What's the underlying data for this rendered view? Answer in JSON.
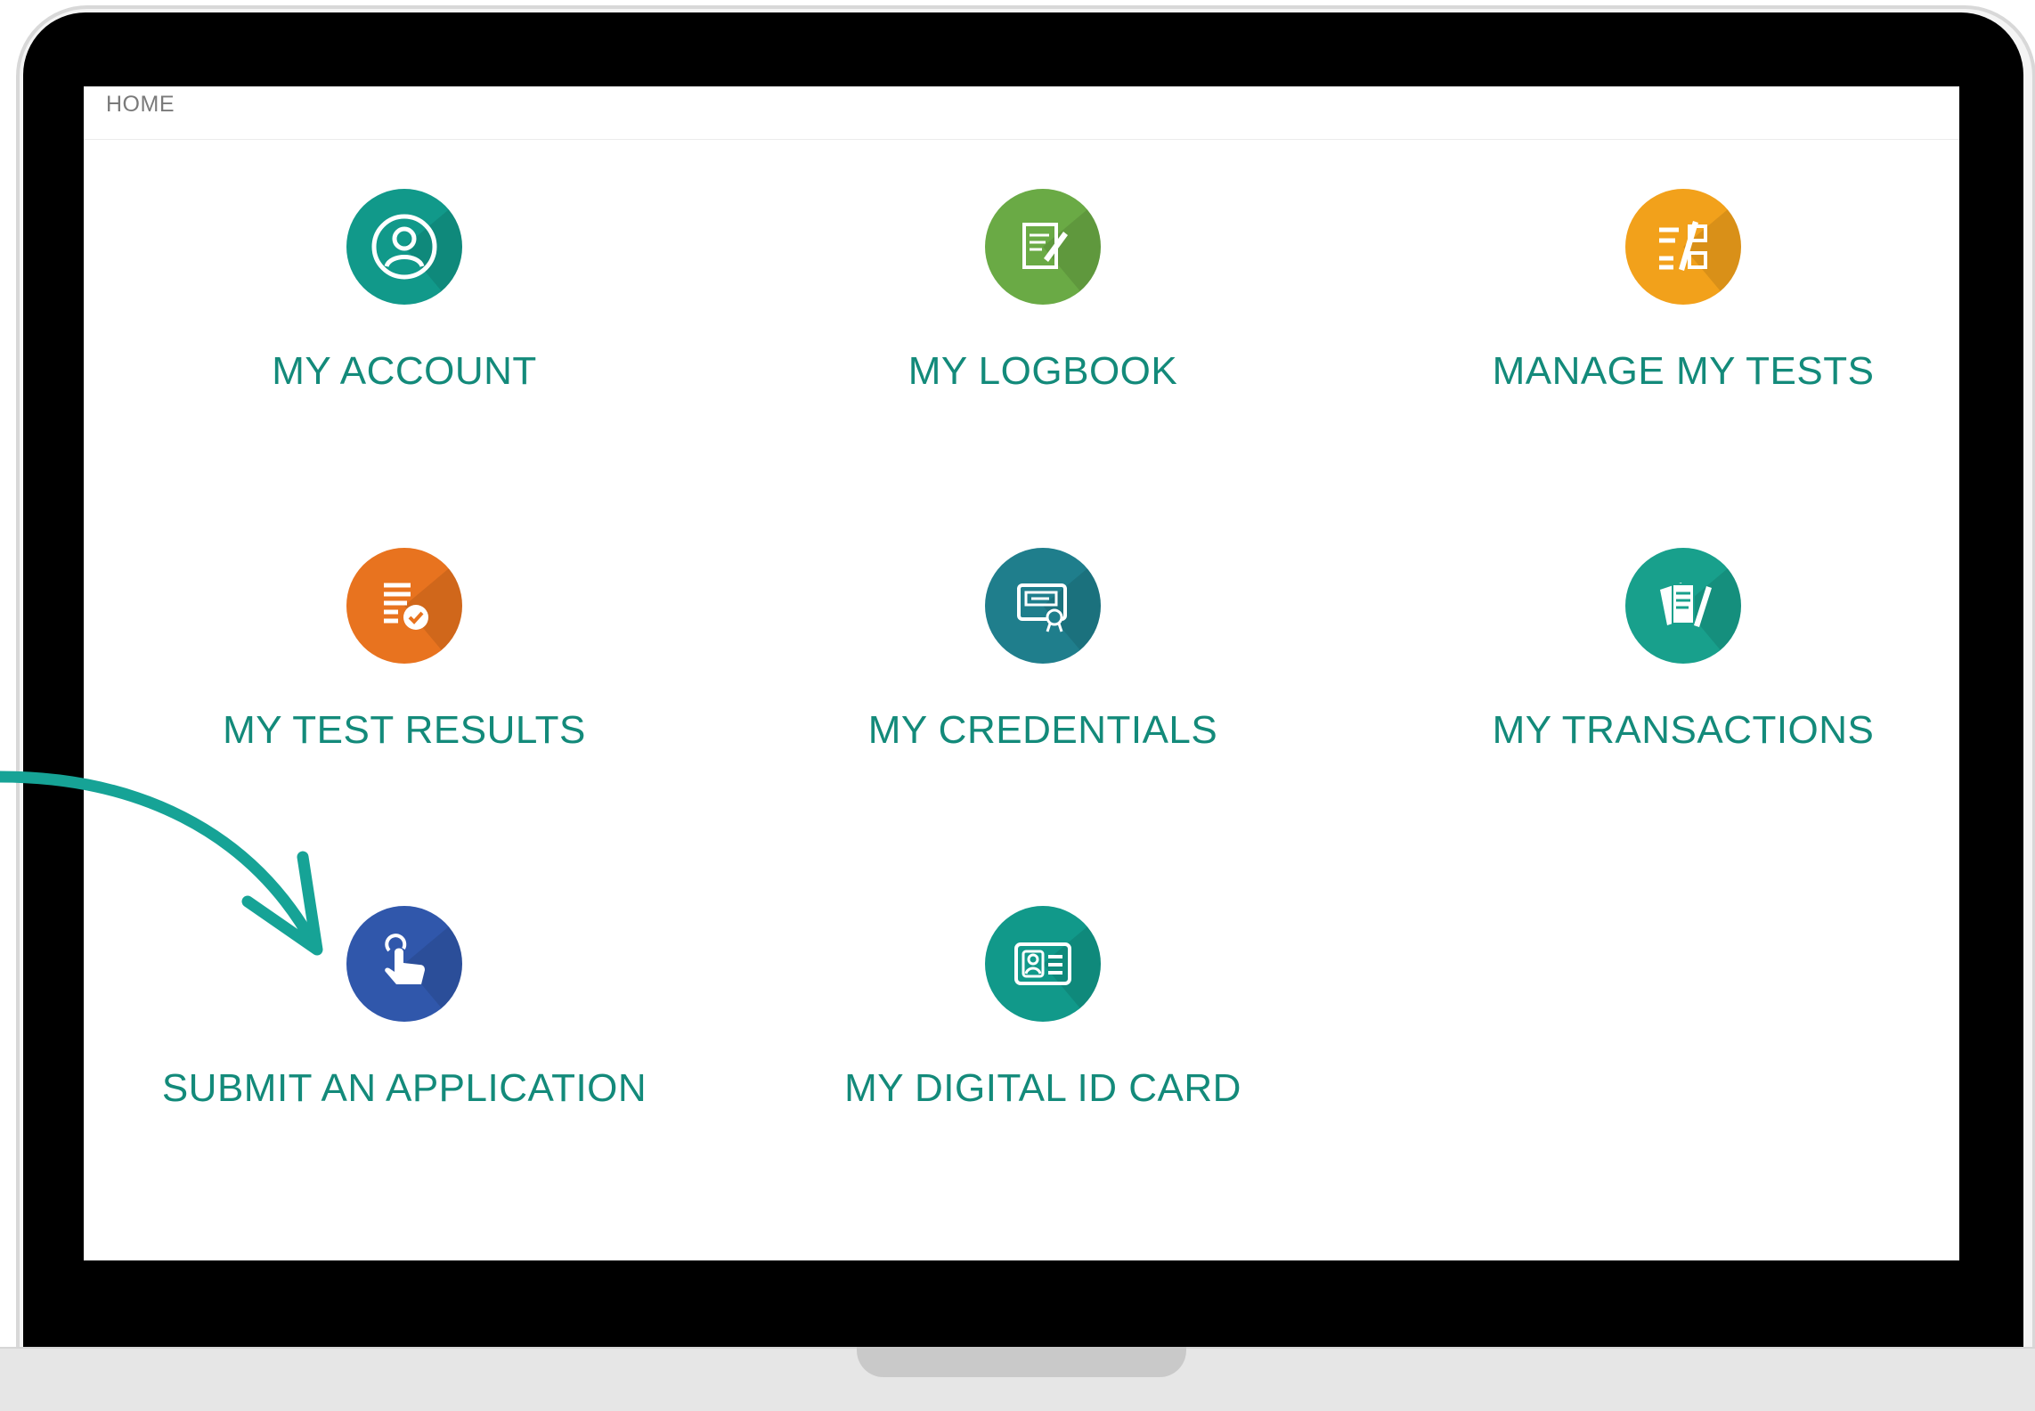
{
  "breadcrumb": "HOME",
  "colors": {
    "label": "#138a7a",
    "arrow": "#16a396"
  },
  "tiles": [
    {
      "label": "MY ACCOUNT",
      "icon": "user-icon",
      "color": "#11998a"
    },
    {
      "label": "MY LOGBOOK",
      "icon": "notepad-icon",
      "color": "#6aaa45"
    },
    {
      "label": "MANAGE MY TESTS",
      "icon": "checklist-icon",
      "color": "#f2a11b"
    },
    {
      "label": "MY TEST RESULTS",
      "icon": "results-icon",
      "color": "#e8731f"
    },
    {
      "label": "MY CREDENTIALS",
      "icon": "certificate-icon",
      "color": "#1f7e8c"
    },
    {
      "label": "MY TRANSACTIONS",
      "icon": "documents-icon",
      "color": "#18a08c"
    },
    {
      "label": "SUBMIT AN APPLICATION",
      "icon": "hand-pointer-icon",
      "color": "#3057ab"
    },
    {
      "label": "MY DIGITAL ID CARD",
      "icon": "id-card-icon",
      "color": "#11998a"
    }
  ]
}
